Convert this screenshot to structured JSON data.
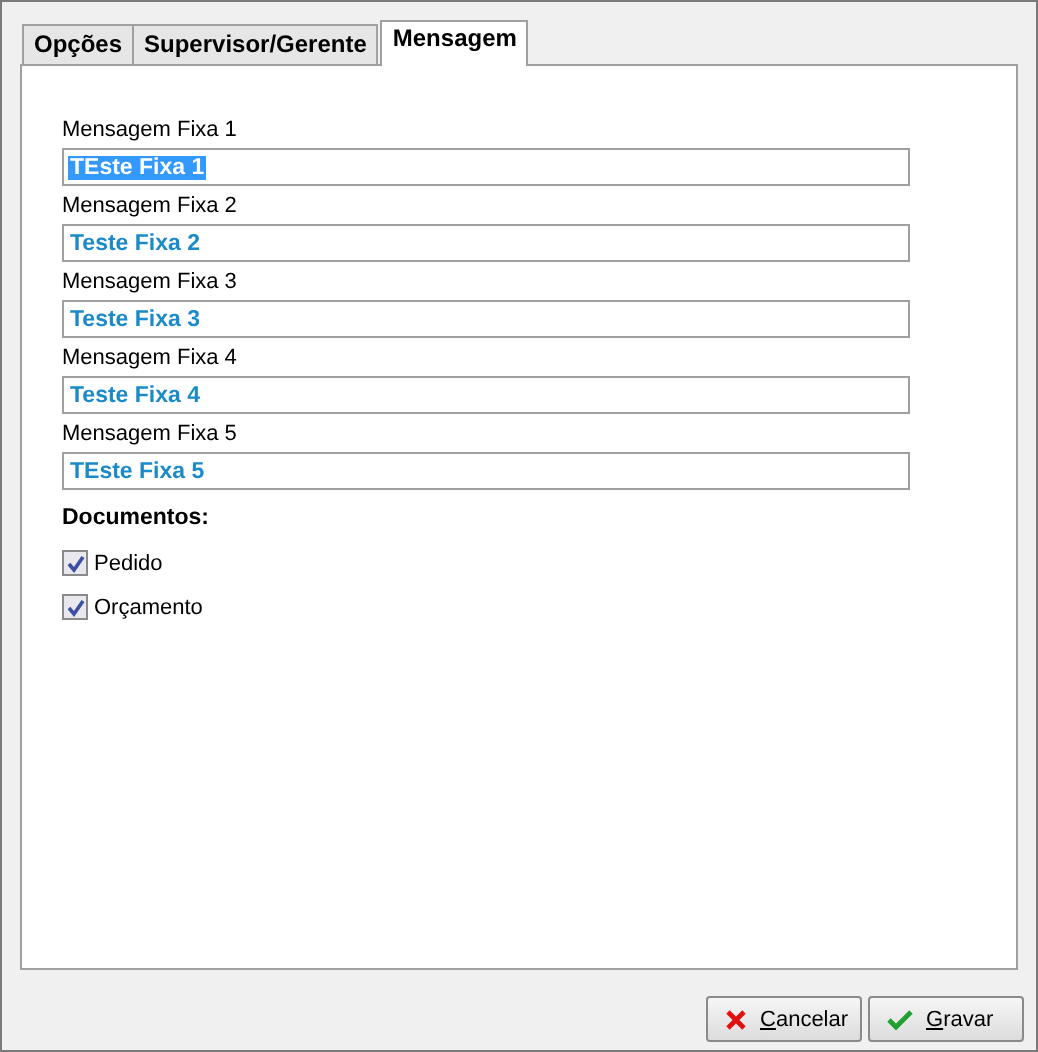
{
  "tabs": [
    {
      "label": "Opções",
      "selected": false
    },
    {
      "label": "Supervisor/Gerente",
      "selected": false
    },
    {
      "label": "Mensagem",
      "selected": true
    }
  ],
  "fields": [
    {
      "label": "Mensagem Fixa 1",
      "value": "TEste Fixa 1",
      "selected": true
    },
    {
      "label": "Mensagem Fixa 2",
      "value": "Teste Fixa 2",
      "selected": false
    },
    {
      "label": "Mensagem Fixa 3",
      "value": "Teste Fixa 3",
      "selected": false
    },
    {
      "label": "Mensagem Fixa 4",
      "value": "Teste Fixa 4",
      "selected": false
    },
    {
      "label": "Mensagem Fixa 5",
      "value": "TEste Fixa 5",
      "selected": false
    }
  ],
  "documents": {
    "title": "Documentos:",
    "items": [
      {
        "label": "Pedido",
        "checked": true
      },
      {
        "label": "Orçamento",
        "checked": true
      }
    ]
  },
  "buttons": [
    {
      "kind": "cancel",
      "label": "Cancelar",
      "mnemonic": true
    },
    {
      "kind": "save",
      "label": "Gravar",
      "mnemonic": true
    }
  ]
}
